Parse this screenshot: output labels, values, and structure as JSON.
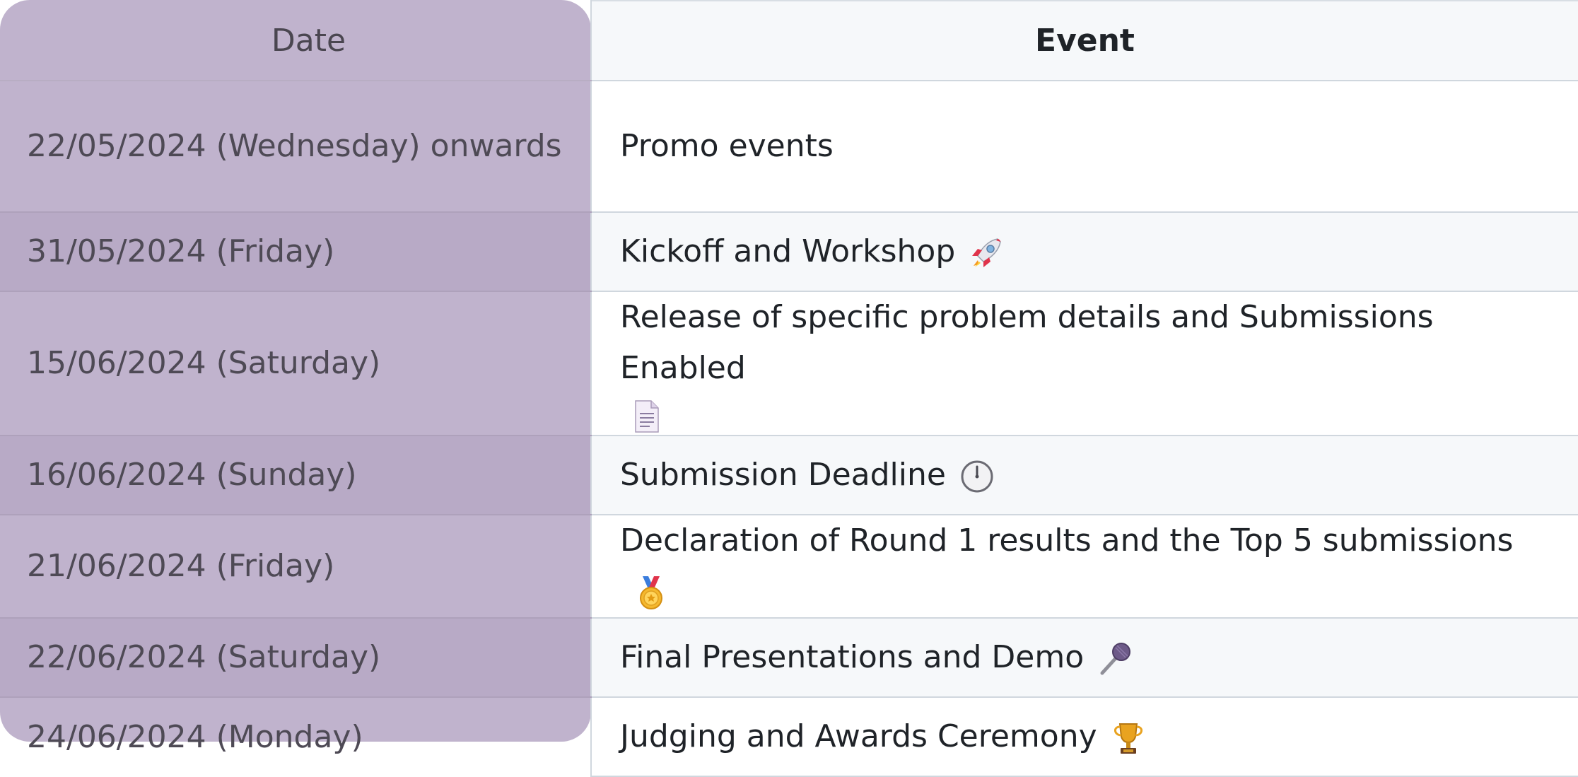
{
  "table": {
    "headers": {
      "date": "Date",
      "event": "Event"
    },
    "rows": [
      {
        "date": "22/05/2024 (Wednesday) onwards",
        "event": "Promo events",
        "icon": ""
      },
      {
        "date": "31/05/2024 (Friday)",
        "event": "Kickoff and Workshop",
        "icon": "rocket-icon"
      },
      {
        "date": "15/06/2024 (Saturday)",
        "event": "Release of specific problem details and Submissions Enabled",
        "icon": "document-icon"
      },
      {
        "date": "16/06/2024 (Sunday)",
        "event": "Submission Deadline",
        "icon": "clock-icon"
      },
      {
        "date": "21/06/2024 (Friday)",
        "event": "Declaration of Round 1 results and the Top 5 submissions",
        "icon": "medal-icon"
      },
      {
        "date": "22/06/2024 (Saturday)",
        "event": "Final Presentations and Demo",
        "icon": "microphone-icon"
      },
      {
        "date": "24/06/2024 (Monday)",
        "event": "Judging and Awards Ceremony",
        "icon": "trophy-icon"
      }
    ]
  },
  "colors": {
    "date_column_bg": "#c0b3cd",
    "alt_row_bg": "#f6f8fa",
    "border": "#d0d7de"
  }
}
